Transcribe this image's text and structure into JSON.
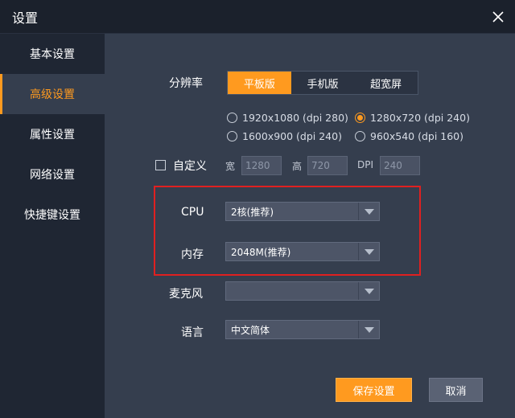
{
  "window": {
    "title": "设置"
  },
  "sidebar": {
    "items": [
      {
        "label": "基本设置",
        "active": false
      },
      {
        "label": "高级设置",
        "active": true
      },
      {
        "label": "属性设置",
        "active": false
      },
      {
        "label": "网络设置",
        "active": false
      },
      {
        "label": "快捷键设置",
        "active": false
      }
    ]
  },
  "resolution": {
    "label": "分辨率",
    "tabs": [
      {
        "label": "平板版",
        "active": true
      },
      {
        "label": "手机版",
        "active": false
      },
      {
        "label": "超宽屏",
        "active": false
      }
    ],
    "options": [
      {
        "label": "1920x1080 (dpi 280)",
        "selected": false
      },
      {
        "label": "1280x720 (dpi 240)",
        "selected": true
      },
      {
        "label": "1600x900 (dpi 240)",
        "selected": false
      },
      {
        "label": "960x540 (dpi 160)",
        "selected": false
      }
    ],
    "custom": {
      "label": "自定义",
      "checked": false,
      "width_label": "宽",
      "width_value": "1280",
      "height_label": "高",
      "height_value": "720",
      "dpi_label": "DPI",
      "dpi_value": "240"
    }
  },
  "cpu": {
    "label": "CPU",
    "value": "2核(推荐)"
  },
  "memory": {
    "label": "内存",
    "value": "2048M(推荐)"
  },
  "microphone": {
    "label": "麦克风",
    "value": ""
  },
  "language": {
    "label": "语言",
    "value": "中文简体"
  },
  "actions": {
    "save_label": "保存设置",
    "cancel_label": "取消"
  },
  "colors": {
    "accent": "#ff9a1f",
    "highlight_border": "#e02020",
    "panel": "#353e4e",
    "sidebar": "#1f2633"
  }
}
